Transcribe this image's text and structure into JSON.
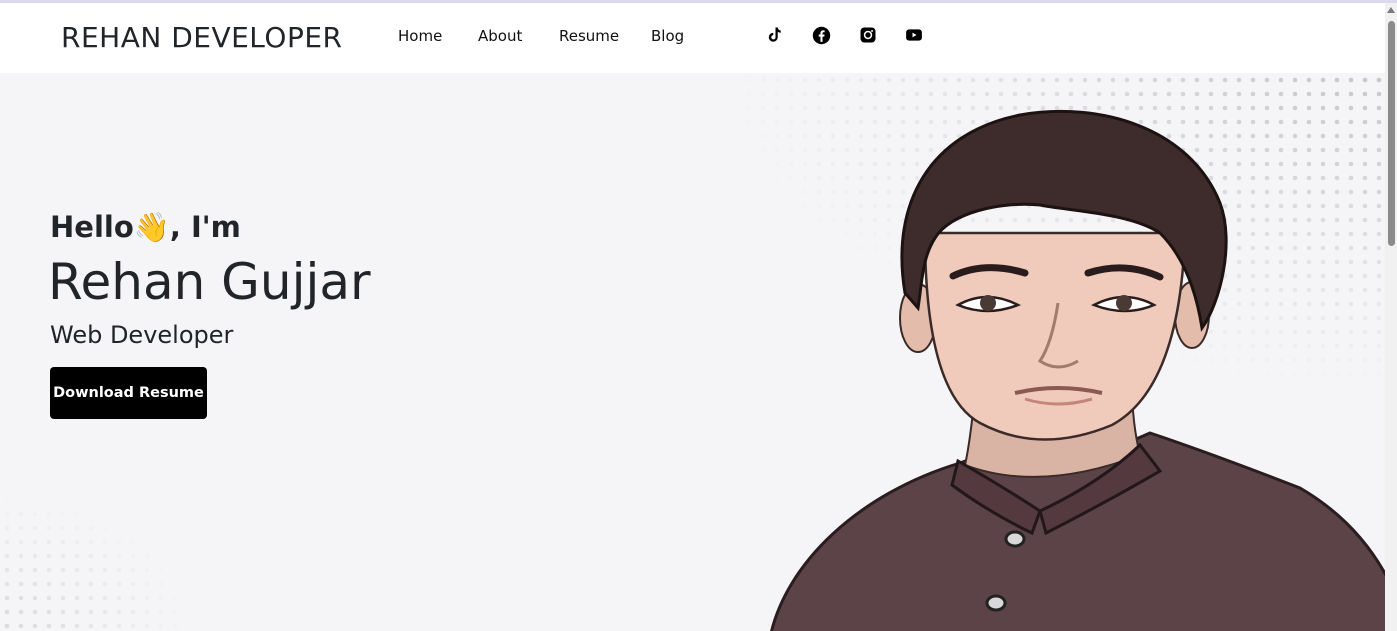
{
  "brand": "REHAN DEVELOPER",
  "nav": {
    "items": [
      {
        "label": "Home"
      },
      {
        "label": "About"
      },
      {
        "label": "Resume"
      },
      {
        "label": "Blog"
      }
    ]
  },
  "social": {
    "icons": [
      "tiktok-icon",
      "facebook-icon",
      "instagram-icon",
      "youtube-icon"
    ]
  },
  "hero": {
    "greeting_before": "Hello",
    "greeting_emoji": "👋",
    "greeting_after": ", I'm",
    "name": "Rehan Gujjar",
    "role": "Web Developer",
    "button_label": "Download Resume"
  },
  "colors": {
    "button_bg": "#000000",
    "hero_bg": "#f5f5f7",
    "text": "#212529"
  }
}
